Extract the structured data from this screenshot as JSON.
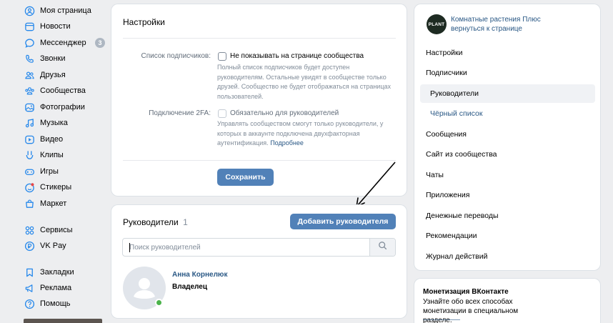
{
  "leftnav": {
    "items": [
      {
        "label": "Моя страница",
        "icon": "user-circle-icon"
      },
      {
        "label": "Новости",
        "icon": "newspaper-icon"
      },
      {
        "label": "Мессенджер",
        "icon": "message-icon",
        "badge": "3"
      },
      {
        "label": "Звонки",
        "icon": "phone-icon"
      },
      {
        "label": "Друзья",
        "icon": "friends-icon"
      },
      {
        "label": "Сообщества",
        "icon": "communities-icon"
      },
      {
        "label": "Фотографии",
        "icon": "photo-icon"
      },
      {
        "label": "Музыка",
        "icon": "music-icon"
      },
      {
        "label": "Видео",
        "icon": "video-icon"
      },
      {
        "label": "Клипы",
        "icon": "clips-icon"
      },
      {
        "label": "Игры",
        "icon": "gamepad-icon"
      },
      {
        "label": "Стикеры",
        "icon": "sticker-icon"
      },
      {
        "label": "Маркет",
        "icon": "market-bag-icon"
      },
      {
        "label": "Сервисы",
        "icon": "services-grid-icon"
      },
      {
        "label": "VK Pay",
        "icon": "vkpay-icon"
      },
      {
        "label": "Закладки",
        "icon": "bookmark-icon"
      },
      {
        "label": "Реклама",
        "icon": "megaphone-icon"
      },
      {
        "label": "Помощь",
        "icon": "help-icon"
      }
    ]
  },
  "settings": {
    "title": "Настройки",
    "subscribers_label": "Список подписчиков:",
    "subscribers_checkbox": "Не показывать на странице сообщества",
    "subscribers_hint": "Полный список подписчиков будет доступен руководителям. Остальные увидят в сообществе только друзей. Сообщество не будет отображаться на страницах пользователей.",
    "twofa_label": "Подключение 2FA:",
    "twofa_checkbox": "Обязательно для руководителей",
    "twofa_hint": "Управлять сообществом смогут только руководители, у которых в аккаунте подключена двухфакторная аутентификация.",
    "twofa_more": "Подробнее",
    "save_button": "Сохранить"
  },
  "leaders": {
    "title": "Руководители",
    "count": "1",
    "add_button": "Добавить руководителя",
    "search_placeholder": "Поиск руководителей",
    "list": [
      {
        "name": "Анна Корнелюк",
        "role": "Владелец",
        "online": true
      }
    ]
  },
  "community_menu": {
    "community_name": "Комнатные растения Плюс",
    "back_link": "вернуться к странице",
    "logo_text": "PLANT",
    "items": [
      {
        "label": "Настройки",
        "level": 0,
        "active": false
      },
      {
        "label": "Подписчики",
        "level": 0,
        "active": false
      },
      {
        "label": "Руководители",
        "level": 1,
        "active": true
      },
      {
        "label": "Чёрный список",
        "level": 1,
        "active": false
      },
      {
        "label": "Сообщения",
        "level": 0,
        "active": false
      },
      {
        "label": "Сайт из сообщества",
        "level": 0,
        "active": false
      },
      {
        "label": "Чаты",
        "level": 0,
        "active": false
      },
      {
        "label": "Приложения",
        "level": 0,
        "active": false
      },
      {
        "label": "Денежные переводы",
        "level": 0,
        "active": false
      },
      {
        "label": "Рекомендации",
        "level": 0,
        "active": false
      },
      {
        "label": "Журнал действий",
        "level": 0,
        "active": false
      }
    ]
  },
  "promo": {
    "title": "Монетизация ВКонтакте",
    "text": "Узнайте обо всех способах монетизации в специальном разделе."
  },
  "colors": {
    "accent": "#5181b8",
    "link": "#2a5885",
    "background": "#edeef0",
    "online": "#4bb34b"
  }
}
